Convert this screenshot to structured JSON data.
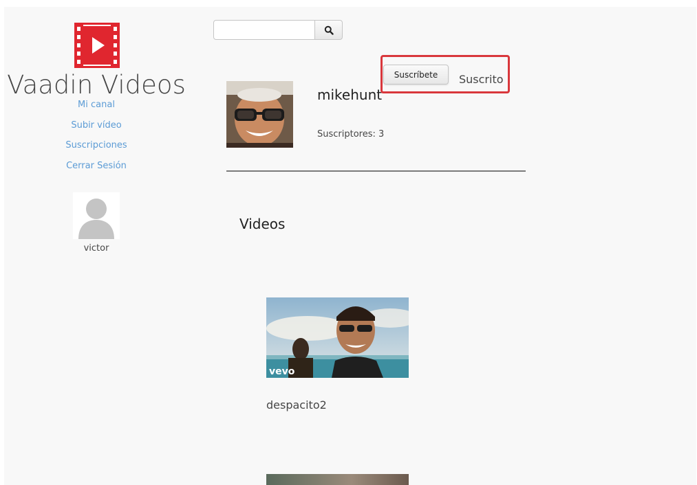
{
  "sidebar": {
    "brand": "Vaadin Videos",
    "logo_icon": "film-play-icon",
    "nav": [
      {
        "label": "Mi canal"
      },
      {
        "label": "Subir vídeo"
      },
      {
        "label": "Suscripciones"
      },
      {
        "label": "Cerrar Sesión"
      }
    ],
    "user": {
      "name": "victor",
      "avatar_icon": "user-silhouette-icon"
    }
  },
  "search": {
    "value": "",
    "button_icon": "search-icon"
  },
  "channel": {
    "name": "mikehunt",
    "subscribers_text": "Suscriptores: 3",
    "subscribe_label": "Suscríbete",
    "subscription_state": "Suscrito"
  },
  "videos": {
    "title": "Videos",
    "items": [
      {
        "title": "despacito2",
        "watermark": "vevo"
      },
      {
        "title": ""
      }
    ]
  },
  "colors": {
    "accent_red": "#e0262f",
    "link_blue": "#5b9bd5",
    "highlight_red": "#d9373c",
    "background": "#f8f8f8"
  }
}
